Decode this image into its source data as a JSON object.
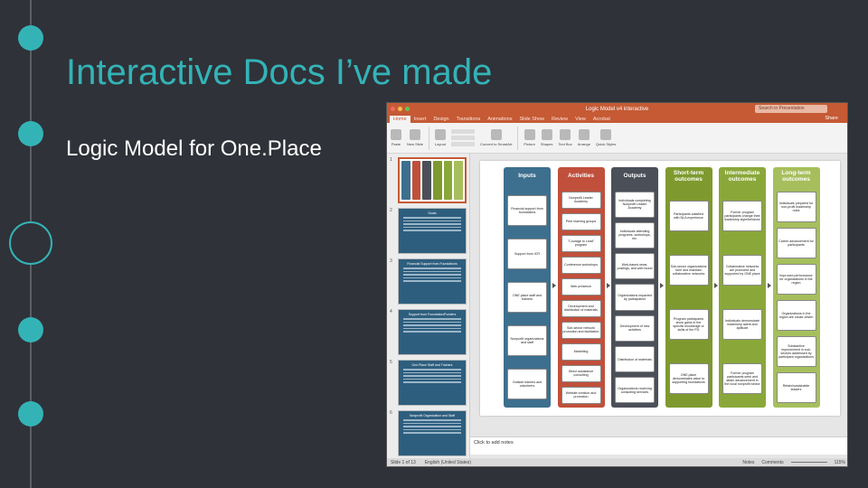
{
  "slide": {
    "title": "Interactive Docs I’ve made",
    "subtitle": "Logic Model for One.Place"
  },
  "colors": {
    "accent": "#34b3b7",
    "background": "#2f3238",
    "ppt_orange": "#c55a34"
  },
  "app": {
    "doc_title": "Logic Model v4 interactive",
    "search_placeholder": "Search in Presentation",
    "share": "Share",
    "tabs": [
      "Home",
      "Insert",
      "Design",
      "Transitions",
      "Animations",
      "Slide Show",
      "Review",
      "View",
      "Acrobat"
    ],
    "ribbon_buttons": [
      "Paste",
      "New Slide",
      "Layout",
      "Convert to SmartArt",
      "Picture",
      "Shapes",
      "Text Box",
      "Arrange",
      "Quick Styles"
    ],
    "notes_placeholder": "Click to add notes",
    "status_left": "Slide 1 of 13",
    "status_lang": "English (United States)",
    "status_notes": "Notes",
    "status_comments": "Comments",
    "zoom": "115%"
  },
  "thumbnails": [
    {
      "num": "1",
      "title": ""
    },
    {
      "num": "2",
      "title": "Goals"
    },
    {
      "num": "3",
      "title": "Financial Support from Foundations"
    },
    {
      "num": "4",
      "title": "Support from Foundation/Funders"
    },
    {
      "num": "5",
      "title": "One.Place Staff and Trainers"
    },
    {
      "num": "6",
      "title": "Nonprofit Organization and Staff"
    },
    {
      "num": "7",
      "title": ""
    }
  ],
  "logic_model": {
    "columns": [
      {
        "head": "Inputs",
        "color": "#3d6f8e",
        "boxes": [
          "Financial support from foundations",
          "Support from ICR",
          "ONE.place staff and trainers",
          "Nonprofit organizations and staff",
          "Outside trainers and volunteers"
        ]
      },
      {
        "head": "Activities",
        "color": "#c0503b",
        "boxes": [
          "Nonprofit Leader Academy",
          "Peer learning groups",
          "\"Courage to Lead\" program",
          "Conference workshops",
          "Web presence",
          "Development and distribution of materials",
          "Sub-sector network promotion and facilitation",
          "Marketing",
          "Direct assistance consulting",
          "Website creation and promotion"
        ]
      },
      {
        "head": "Outputs",
        "color": "#4b4f58",
        "boxes": [
          "Individuals completing Nonprofit Leader Academy",
          "Individuals attending programs, workshops, etc.",
          "Web-based news, postings, and web found",
          "Organizations impacted by participation",
          "Development of new activities",
          "Distribution of materials",
          "Organizations receiving consulting services"
        ]
      },
      {
        "head": "Short-term outcomes",
        "color": "#7e9a2f",
        "boxes": [
          "Participants satisfied with NLA experience",
          "Sub-sector organizations form and maintain collaborative networks",
          "Program participants show gains in the specific knowledge or skills of the PG",
          "ONE.place demonstrates value to supporting foundations"
        ]
      },
      {
        "head": "Intermediate outcomes",
        "color": "#8aa83a",
        "boxes": [
          "Former program participants change their leadership style/behavior",
          "Collaborative networks are promoted and supported by ONE.place",
          "Individuals demonstrate leadership talent and aptitude",
          "Former program participants seek and attain advancement in the local nonprofit sector"
        ]
      },
      {
        "head": "Long-term outcomes",
        "color": "#a6bf5c",
        "boxes": [
          "Individuals prepared for non-profit leadership roles",
          "Career advancement for participants",
          "Improved performance for organizations in the region",
          "Organizations in the region are cause-driven",
          "Substantive improvement in sub-sectors addressed by participant organizations",
          "Retain/sustainable leaders"
        ]
      }
    ]
  }
}
